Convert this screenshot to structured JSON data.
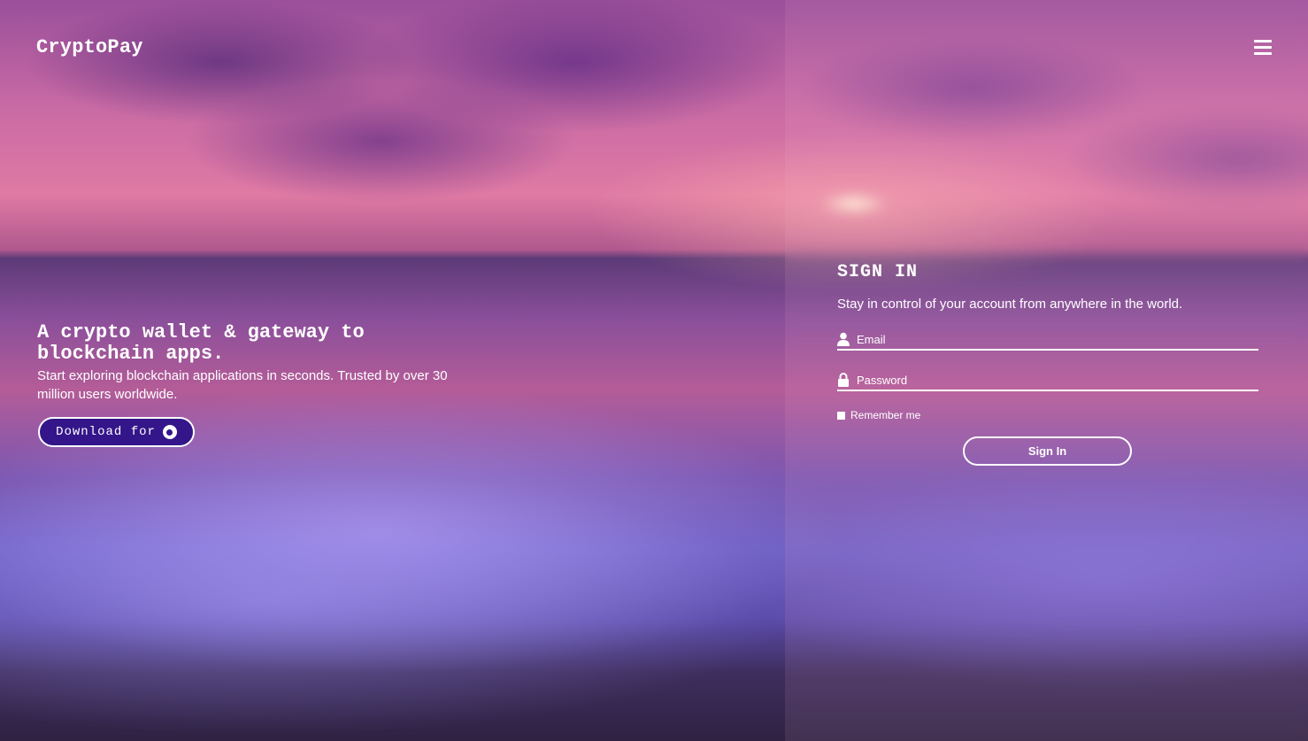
{
  "header": {
    "logo": "CryptoPay",
    "menu_icon": "hamburger-menu-icon"
  },
  "hero": {
    "title": "A crypto wallet & gateway to blockchain apps.",
    "description": "Start exploring blockchain applications in seconds. Trusted by over 30 million users worldwide.",
    "download_label": "Download for",
    "download_icon": "chrome-icon"
  },
  "signin": {
    "title": "SIGN IN",
    "subtitle": "Stay in control of your account from anywhere in the world.",
    "email_placeholder": "Email",
    "email_icon": "user-icon",
    "password_placeholder": "Password",
    "password_icon": "lock-icon",
    "remember_label": "Remember me",
    "submit_label": "Sign In"
  },
  "colors": {
    "download_button_bg": "#34168a",
    "text": "#ffffff"
  }
}
